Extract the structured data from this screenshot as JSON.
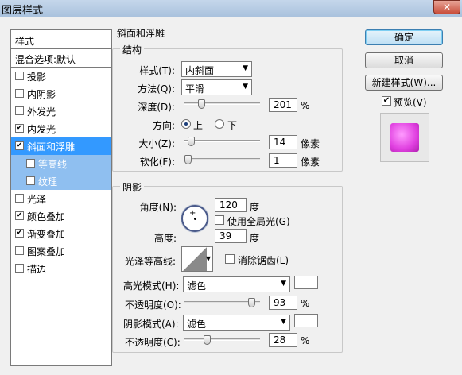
{
  "window": {
    "title": "图层样式",
    "close_glyph": "✕"
  },
  "styles_panel": {
    "header": "样式",
    "blend_options": "混合选项:默认",
    "items": [
      {
        "label": "投影",
        "checked": false
      },
      {
        "label": "内阴影",
        "checked": false
      },
      {
        "label": "外发光",
        "checked": false
      },
      {
        "label": "内发光",
        "checked": true
      },
      {
        "label": "斜面和浮雕",
        "checked": true
      },
      {
        "label": "等高线",
        "checked": false
      },
      {
        "label": "纹理",
        "checked": false
      },
      {
        "label": "光泽",
        "checked": false
      },
      {
        "label": "颜色叠加",
        "checked": true
      },
      {
        "label": "渐变叠加",
        "checked": true
      },
      {
        "label": "图案叠加",
        "checked": false
      },
      {
        "label": "描边",
        "checked": false
      }
    ],
    "check_glyph": "✔"
  },
  "bevel": {
    "section_title": "斜面和浮雕",
    "structure": {
      "title": "结构",
      "style_label": "样式(T):",
      "style_value": "内斜面",
      "technique_label": "方法(Q):",
      "technique_value": "平滑",
      "depth_label": "深度(D):",
      "depth_value": "201",
      "depth_unit": "%",
      "direction_label": "方向:",
      "direction_up": "上",
      "direction_down": "下",
      "size_label": "大小(Z):",
      "size_value": "14",
      "size_unit": "像素",
      "soften_label": "软化(F):",
      "soften_value": "1",
      "soften_unit": "像素"
    },
    "shading": {
      "title": "阴影",
      "angle_label": "角度(N):",
      "angle_value": "120",
      "angle_unit": "度",
      "global_light_label": "使用全局光(G)",
      "altitude_label": "高度:",
      "altitude_value": "39",
      "altitude_unit": "度",
      "gloss_contour_label": "光泽等高线:",
      "anti_aliased_label": "消除锯齿(L)",
      "highlight_mode_label": "高光模式(H):",
      "highlight_mode_value": "滤色",
      "highlight_color": "#ffffff",
      "highlight_opacity_label": "不透明度(O):",
      "highlight_opacity_value": "93",
      "shadow_mode_label": "阴影模式(A):",
      "shadow_mode_value": "滤色",
      "shadow_color": "#ffffff",
      "shadow_opacity_label": "不透明度(C):",
      "shadow_opacity_value": "28",
      "percent_unit": "%"
    }
  },
  "actions": {
    "ok": "确定",
    "cancel": "取消",
    "new_style": "新建样式(W)...",
    "preview_label": "预览(V)",
    "preview_checked": true
  },
  "sliders": {
    "depth_fraction": 0.2,
    "size_fraction": 0.05,
    "soften_fraction": 0.0,
    "highlight_opacity_fraction": 0.93,
    "shadow_opacity_fraction": 0.28
  },
  "preview_color": "#e040e0",
  "dropdown_arrow": "▼",
  "angle_crosshair": "+"
}
